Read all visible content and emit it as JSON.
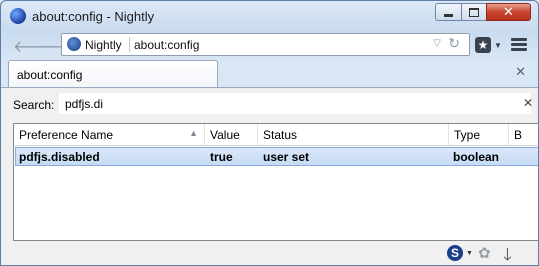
{
  "window": {
    "title": "about:config - Nightly"
  },
  "navbar": {
    "identity_label": "Nightly",
    "url": "about:config"
  },
  "tab": {
    "label": "about:config"
  },
  "search": {
    "label": "Search:",
    "value": "pdfjs.di"
  },
  "table": {
    "columns": [
      "Preference Name",
      "Value",
      "Status",
      "Type",
      "B"
    ],
    "rows": [
      {
        "name": "pdfjs.disabled",
        "value": "true",
        "status": "user set",
        "type": "boolean"
      }
    ]
  },
  "statusbar": {
    "addon_s_label": "S"
  },
  "icons": {
    "app": "nightly-globe-icon",
    "back": "back-arrow-icon",
    "forward": "forward-arrow-icon",
    "reload": "reload-icon",
    "bookmark": "bookmark-star-icon",
    "menu": "hamburger-menu-icon",
    "close_tab": "close-icon"
  },
  "colors": {
    "selection": "#c5dbf5",
    "close_button": "#c8442d"
  }
}
